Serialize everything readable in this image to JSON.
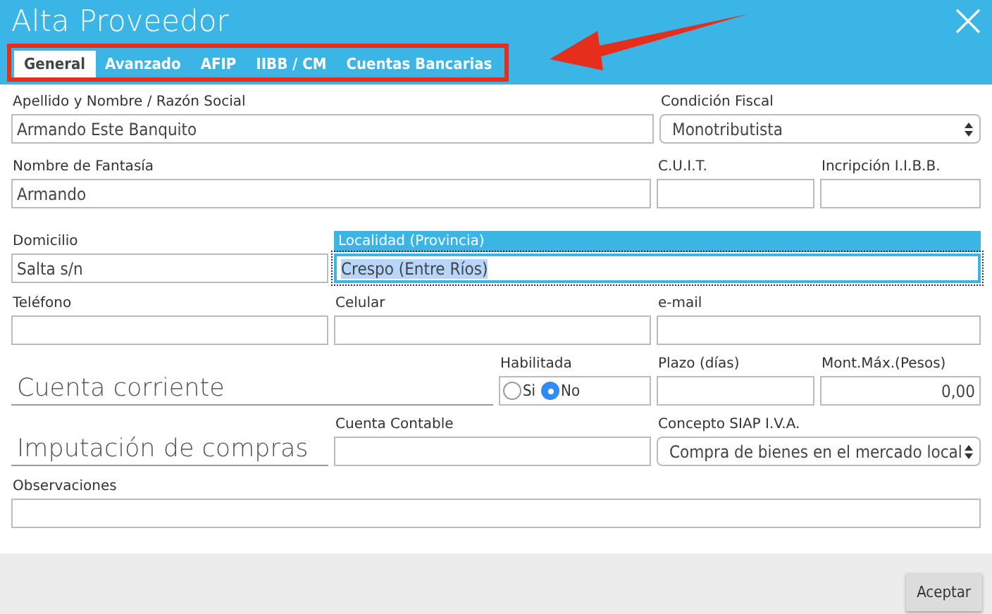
{
  "window": {
    "title": "Alta Proveedor"
  },
  "tabs": [
    {
      "label": "General",
      "selected": true
    },
    {
      "label": "Avanzado",
      "selected": false
    },
    {
      "label": "AFIP",
      "selected": false
    },
    {
      "label": "IIBB / CM",
      "selected": false
    },
    {
      "label": "Cuentas Bancarias",
      "selected": false
    }
  ],
  "form_rows": [
    [
      {
        "kind": "text",
        "label": "Apellido y Nombre / Razón Social",
        "value": "Armando Este Banquito",
        "focused": false
      },
      {
        "kind": "select",
        "label": "Condición Fiscal",
        "value": "Monotributista"
      }
    ],
    [
      {
        "kind": "text",
        "label": "Nombre de Fantasía",
        "value": "Armando",
        "focused": false
      },
      {
        "kind": "text",
        "label": "C.U.I.T.",
        "focused": false
      },
      {
        "kind": "text",
        "label": "Incripción I.I.B.B.",
        "focused": false
      }
    ],
    [
      {
        "kind": "text",
        "label": "Domicilio",
        "value": "Salta s/n",
        "focused": false
      },
      {
        "kind": "text",
        "label": "Localidad (Provincia)",
        "value": "Crespo (Entre Ríos)",
        "focused": true
      }
    ],
    [
      {
        "kind": "text",
        "label": "Teléfono",
        "focused": false
      },
      {
        "kind": "text",
        "label": "Celular",
        "focused": false
      },
      {
        "kind": "text",
        "label": "e-mail",
        "focused": false
      }
    ],
    [
      {
        "kind": "heading",
        "label": "Cuenta corriente"
      },
      {
        "kind": "radio",
        "label": "Habilitada",
        "options": [
          {
            "label": "Si",
            "selected": false
          },
          {
            "label": "No",
            "selected": true
          }
        ]
      },
      {
        "kind": "text",
        "label": "Plazo (días)",
        "focused": false
      },
      {
        "kind": "number",
        "label": "Mont.Máx.(Pesos)",
        "value": "0,00"
      }
    ],
    [
      {
        "kind": "heading",
        "label": "Imputación de compras"
      },
      {
        "kind": "text",
        "label": "Cuenta Contable",
        "focused": false
      },
      {
        "kind": "select",
        "label": "Concepto SIAP I.V.A.",
        "value": "Compra de bienes en el mercado local"
      }
    ],
    [
      {
        "kind": "text",
        "label": "Observaciones",
        "focused": false
      }
    ]
  ],
  "buttons": [
    {
      "label": "Aceptar"
    }
  ]
}
